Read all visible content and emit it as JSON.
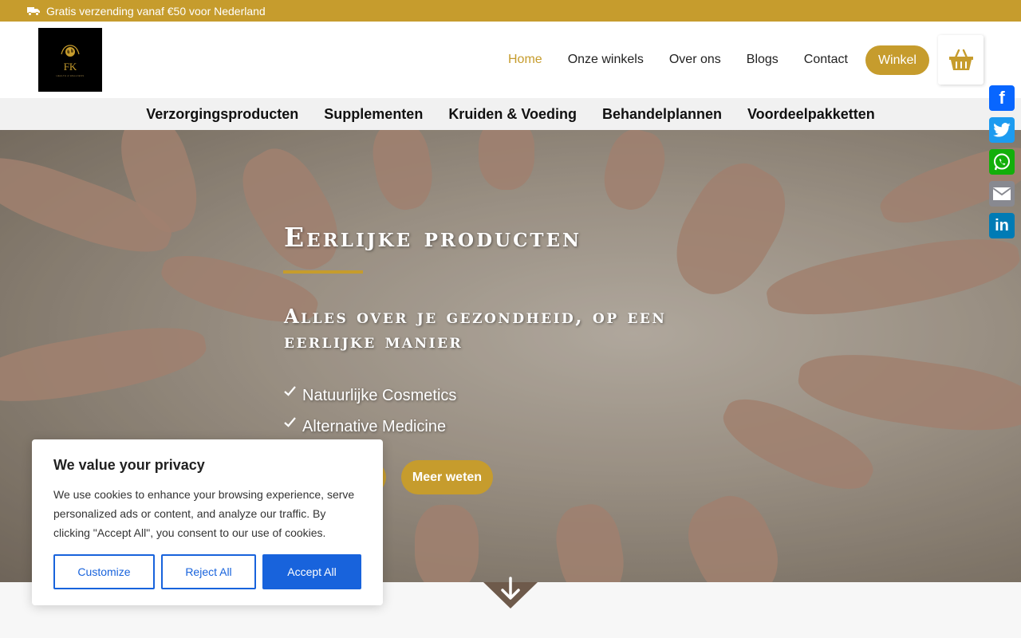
{
  "topbar": {
    "icon": "truck-icon",
    "text": "Gratis verzending vanaf €50 voor Nederland"
  },
  "logo": {
    "initials": "FK",
    "tagline": "HEALTH & WELLNESS"
  },
  "nav": {
    "items": [
      {
        "label": "Home",
        "active": true
      },
      {
        "label": "Onze winkels",
        "active": false
      },
      {
        "label": "Over ons",
        "active": false
      },
      {
        "label": "Blogs",
        "active": false
      },
      {
        "label": "Contact",
        "active": false
      }
    ],
    "cta": "Winkel",
    "cart_icon": "basket-icon"
  },
  "categories": [
    "Verzorgingsproducten",
    "Supplementen",
    "Kruiden & Voeding",
    "Behandelplannen",
    "Voordeelpakketten"
  ],
  "hero": {
    "title": "Eerlijke producten",
    "subtitle": "Alles over je gezondheid, op een eerlijke manier",
    "bullets": [
      "Natuurlijke Cosmetics",
      "Alternative Medicine"
    ],
    "buttons": [
      "",
      "Meer weten"
    ],
    "scroll_icon": "arrow-down-icon"
  },
  "share": {
    "items": [
      {
        "name": "Facebook",
        "icon": "facebook-icon",
        "glyph": "f"
      },
      {
        "name": "Twitter",
        "icon": "twitter-icon",
        "glyph": ""
      },
      {
        "name": "WhatsApp",
        "icon": "whatsapp-icon",
        "glyph": ""
      },
      {
        "name": "Email",
        "icon": "email-icon",
        "glyph": ""
      },
      {
        "name": "LinkedIn",
        "icon": "linkedin-icon",
        "glyph": "in"
      }
    ]
  },
  "cookie": {
    "title": "We value your privacy",
    "text": "We use cookies to enhance your browsing experience, serve personalized ads or content, and analyze our traffic. By clicking \"Accept All\", you consent to our use of cookies.",
    "customize": "Customize",
    "reject": "Reject All",
    "accept": "Accept All"
  },
  "colors": {
    "accent": "#c69c2d",
    "cookie_blue": "#1863dc"
  }
}
